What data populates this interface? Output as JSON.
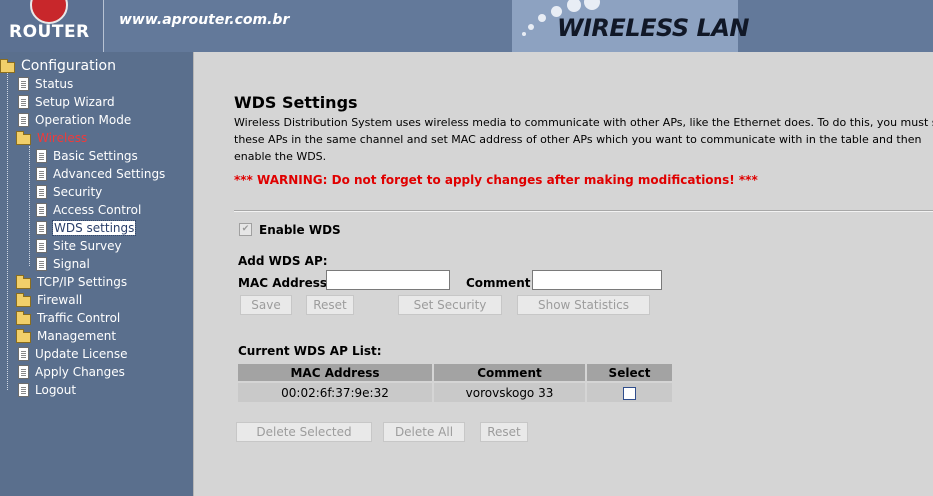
{
  "header": {
    "logo_text": "ROUTER",
    "site_url": "www.aprouter.com.br",
    "brand_text": "WIRELESS LAN"
  },
  "sidebar": {
    "root": "Configuration",
    "items": [
      {
        "label": "Status",
        "type": "page"
      },
      {
        "label": "Setup Wizard",
        "type": "page"
      },
      {
        "label": "Operation Mode",
        "type": "page"
      },
      {
        "label": "Wireless",
        "type": "folder",
        "expanded": true,
        "active": true,
        "children": [
          {
            "label": "Basic Settings"
          },
          {
            "label": "Advanced Settings"
          },
          {
            "label": "Security"
          },
          {
            "label": "Access Control"
          },
          {
            "label": "WDS settings",
            "selected": true
          },
          {
            "label": "Site Survey"
          },
          {
            "label": "Signal"
          }
        ]
      },
      {
        "label": "TCP/IP Settings",
        "type": "folder"
      },
      {
        "label": "Firewall",
        "type": "folder"
      },
      {
        "label": "Traffic Control",
        "type": "folder"
      },
      {
        "label": "Management",
        "type": "folder"
      },
      {
        "label": "Update License",
        "type": "page"
      },
      {
        "label": "Apply Changes",
        "type": "page"
      },
      {
        "label": "Logout",
        "type": "page"
      }
    ]
  },
  "main": {
    "title": "WDS Settings",
    "description": "Wireless Distribution System uses wireless media to communicate with other APs, like the Ethernet does. To do this, you must set these APs in the same channel and set MAC address of other APs which you want to communicate with in the table and then enable the WDS.",
    "warning": "*** WARNING: Do not forget to apply changes after making modifications! ***",
    "enable_wds_label": "Enable WDS",
    "enable_wds_checked": true,
    "add_heading": "Add WDS AP:",
    "mac_label": "MAC Address",
    "mac_value": "",
    "comment_label": "Comment",
    "comment_value": "",
    "buttons": {
      "save": "Save",
      "reset": "Reset",
      "set_security": "Set Security",
      "show_statistics": "Show Statistics"
    },
    "list_heading": "Current WDS AP List:",
    "table": {
      "columns": [
        "MAC Address",
        "Comment",
        "Select"
      ],
      "rows": [
        {
          "mac": "00:02:6f:37:9e:32",
          "comment": "vorovskogo 33",
          "selected": false
        }
      ]
    },
    "table_buttons": {
      "delete_selected": "Delete Selected",
      "delete_all": "Delete All",
      "reset": "Reset"
    }
  },
  "colors": {
    "header_bg": "#63799a",
    "sidebar_bg": "#5a6f8d",
    "active_item": "#f03a3a",
    "warning": "#e00000",
    "content_bg": "#d5d5d5"
  }
}
